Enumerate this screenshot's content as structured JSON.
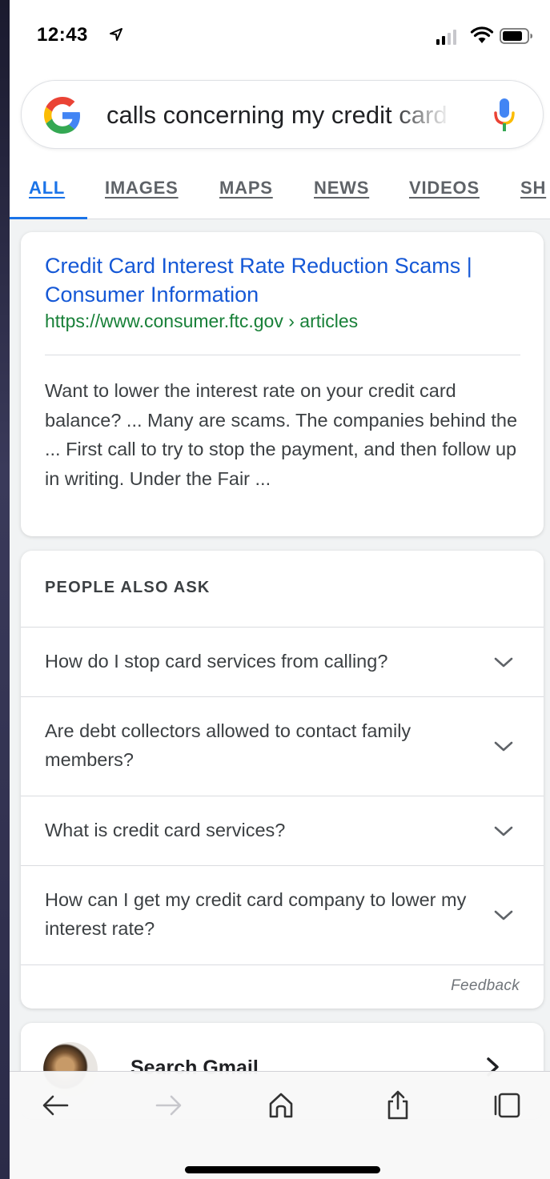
{
  "status_bar": {
    "time": "12:43",
    "icons": [
      "location-arrow-icon",
      "cellular-signal-icon",
      "wifi-icon",
      "battery-icon"
    ]
  },
  "search": {
    "query": "calls concerning my credit card services",
    "icons": [
      "google-g-logo",
      "microphone-icon"
    ]
  },
  "tabs": [
    {
      "label": "ALL",
      "active": true
    },
    {
      "label": "IMAGES",
      "active": false
    },
    {
      "label": "MAPS",
      "active": false
    },
    {
      "label": "NEWS",
      "active": false
    },
    {
      "label": "VIDEOS",
      "active": false
    },
    {
      "label": "SH",
      "active": false
    }
  ],
  "result": {
    "title": "Credit Card Interest Rate Reduction Scams | Consumer Information",
    "url": "https://www.consumer.ftc.gov › articles",
    "snippet": "Want to lower the interest rate on your credit card balance? ... Many are scams. The companies behind the ... First call to try to stop the payment, and then follow up in writing. Under the Fair ..."
  },
  "people_also_ask": {
    "heading": "PEOPLE ALSO ASK",
    "questions": [
      "How do I stop card services from calling?",
      "Are debt collectors allowed to contact family members?",
      "What is credit card services?",
      "How can I get my credit card company to lower my interest rate?"
    ],
    "feedback": "Feedback"
  },
  "gmail": {
    "label": "Search Gmail"
  },
  "toolbar": {
    "icons": [
      "back-arrow-icon",
      "forward-arrow-icon",
      "home-icon",
      "share-icon",
      "tabs-icon"
    ]
  },
  "colors": {
    "link_blue": "#1558d6",
    "url_green": "#188038",
    "accent_blue": "#1a73e8",
    "text_gray": "#3c4043"
  }
}
